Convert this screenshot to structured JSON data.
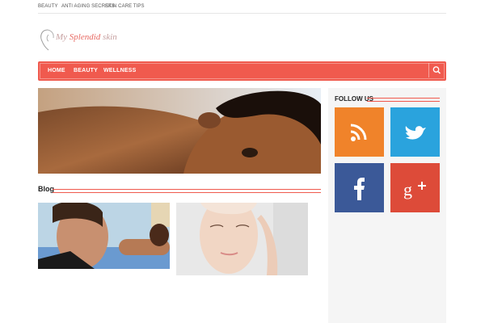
{
  "top_nav": {
    "links": [
      "BEAUTY",
      "ANTI AGING SECRETS",
      "SKIN CARE TIPS"
    ]
  },
  "logo": {
    "text_part1": "My",
    "text_part2": " Splendid",
    "text_part3": " skin"
  },
  "main_nav": {
    "items": [
      "HOME",
      "BEAUTY",
      "WELLNESS"
    ],
    "search_icon": "search-icon"
  },
  "hero": {
    "image_label": "woman-lying-face-closeup"
  },
  "blog": {
    "title": "Blog",
    "thumbnails": [
      "friends-beach-photo",
      "woman-skin-care-face"
    ]
  },
  "sidebar": {
    "follow_title": "FOLLOW US",
    "social": [
      {
        "icon": "rss-icon",
        "color": "#f0832a"
      },
      {
        "icon": "twitter-icon",
        "color": "#2aa3dd"
      },
      {
        "icon": "facebook-icon",
        "color": "#3b5998"
      },
      {
        "icon": "google-plus-icon",
        "color": "#dd4b39"
      }
    ]
  },
  "colors": {
    "accent": "#f05a4e",
    "sidebar_bg": "#f5f5f5"
  }
}
